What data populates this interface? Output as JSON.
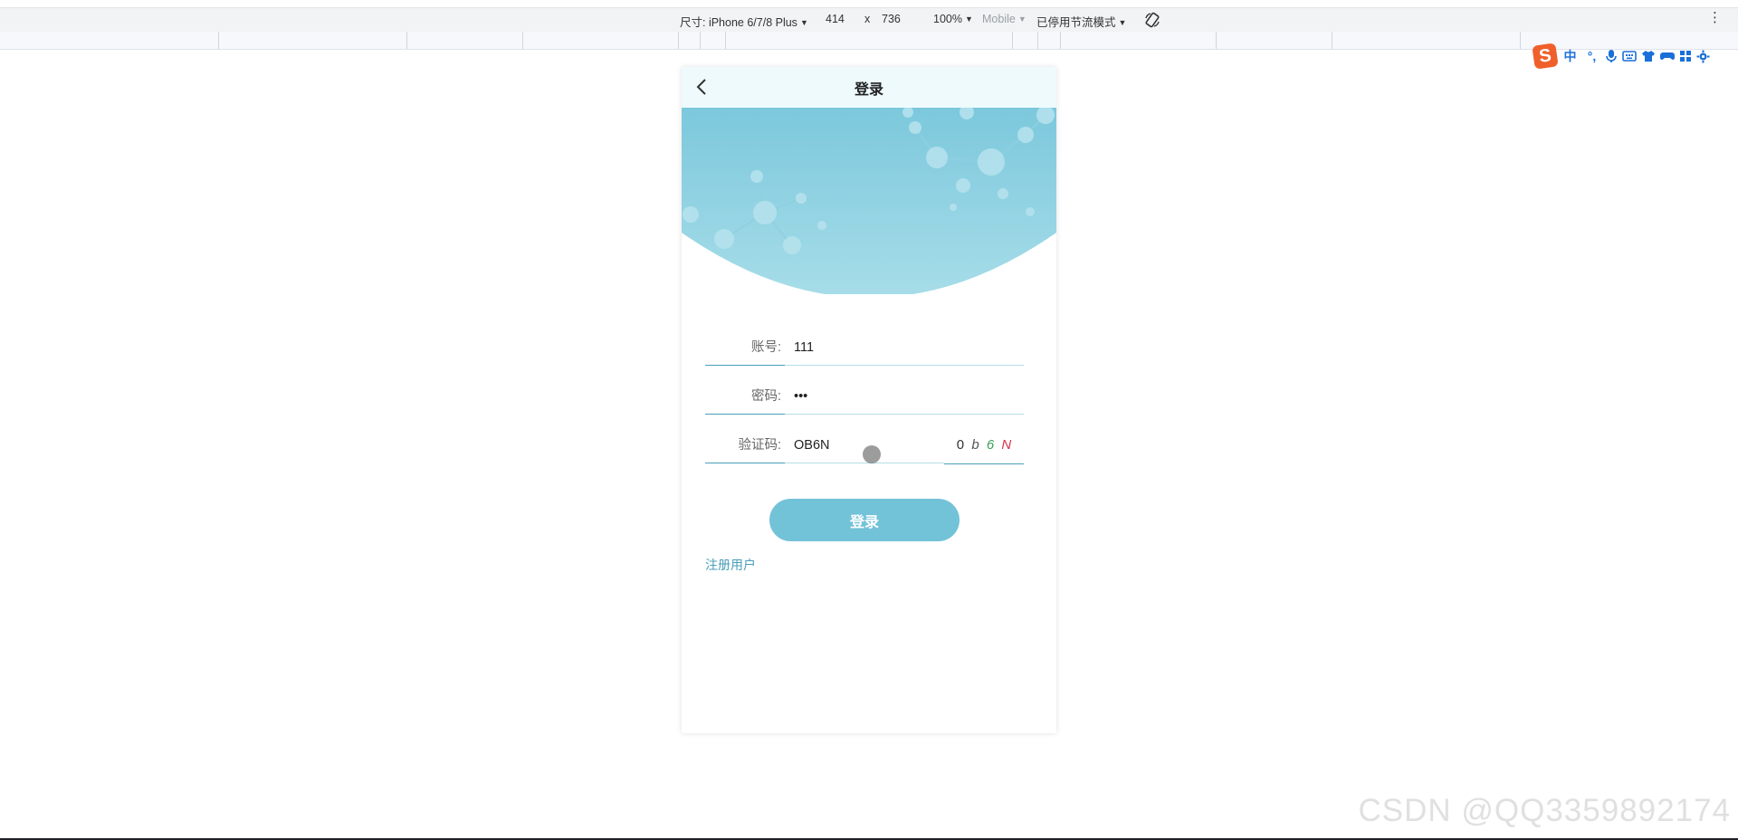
{
  "devtools": {
    "device_label": "尺寸: iPhone 6/7/8 Plus",
    "width": "414",
    "times": "x",
    "height": "736",
    "zoom": "100%",
    "mobile": "Mobile",
    "throttle": "已停用节流模式",
    "menu": "⋮"
  },
  "ime": {
    "logo": "S",
    "lang": "中"
  },
  "phone": {
    "title": "登录",
    "form": {
      "account_label": "账号:",
      "account_value": "111",
      "password_label": "密码:",
      "password_value": "•••",
      "captcha_label": "验证码:",
      "captcha_value": "OB6N",
      "captcha_chars": [
        "0",
        "b",
        "6",
        "N"
      ]
    },
    "login_button": "登录",
    "register_link": "注册用户"
  },
  "watermark": "CSDN @QQ3359892174",
  "colors": {
    "accent": "#4a9fb8",
    "button": "#72c2d8",
    "banner_top": "#7cc8dc",
    "banner_bottom": "#a7dde9"
  }
}
